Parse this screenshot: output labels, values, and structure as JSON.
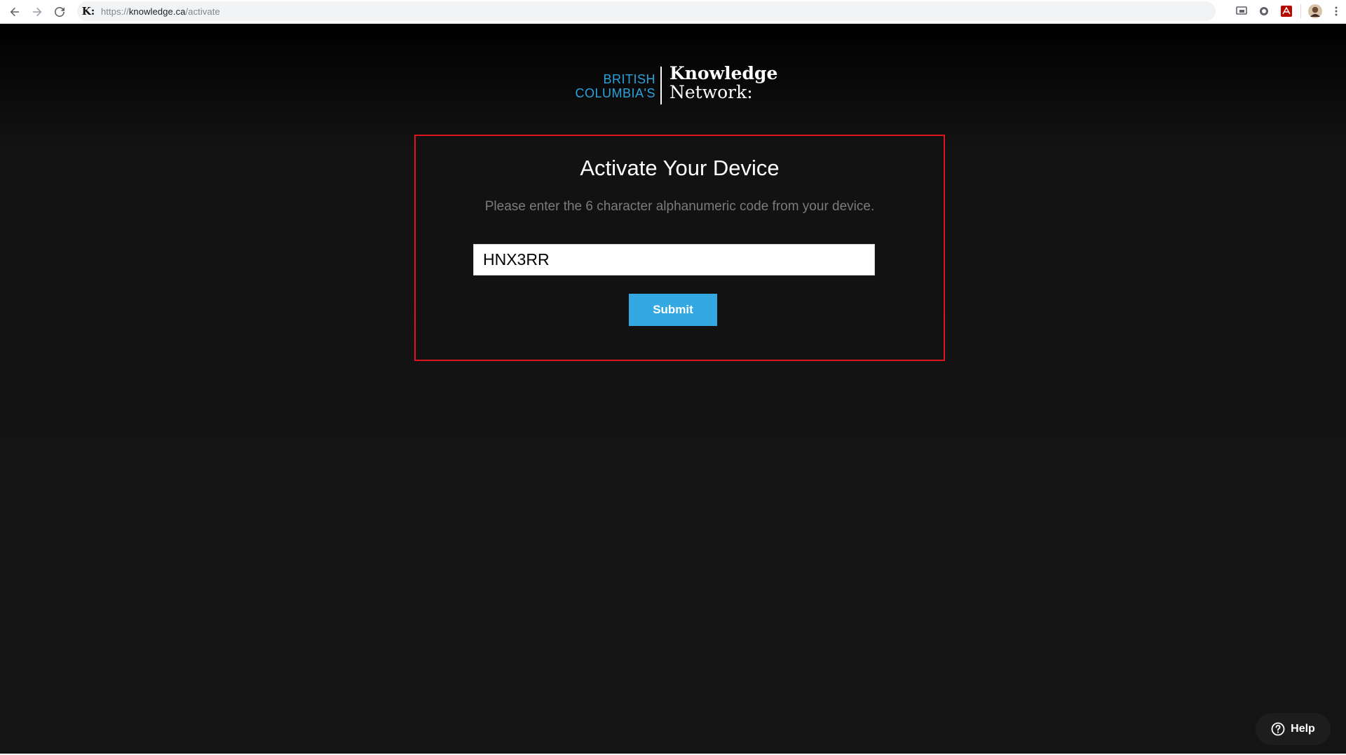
{
  "browser": {
    "url": {
      "scheme": "https://",
      "host": "knowledge.ca",
      "path": "/activate"
    },
    "site_icon_glyph": "K:",
    "icons": [
      "back-arrow-icon",
      "forward-arrow-icon",
      "reload-icon",
      "cast-icon",
      "extension-circle-icon",
      "pdf-extension-icon",
      "profile-avatar",
      "more-menu-icon"
    ]
  },
  "logo": {
    "line1": "BRITISH",
    "line2": "COLUMBIA'S",
    "brand1": "Knowledge",
    "brand2": "Network:"
  },
  "activation": {
    "title": "Activate Your Device",
    "subtitle": "Please enter the 6 character alphanumeric code from your device.",
    "code_value": "HNX3RR",
    "submit_label": "Submit"
  },
  "help": {
    "label": "Help"
  },
  "colors": {
    "accent_blue": "#33a8e2",
    "logo_blue": "#2aa3dd",
    "panel_border": "#e0141e",
    "page_background": "#141414"
  }
}
